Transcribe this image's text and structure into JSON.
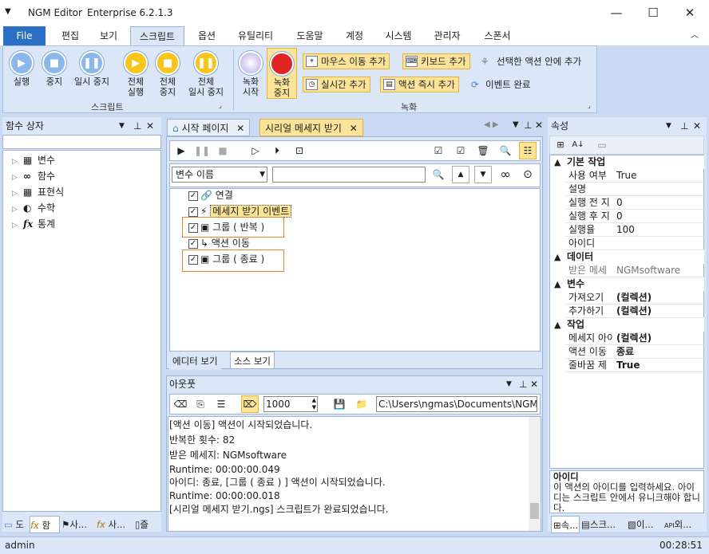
{
  "window": {
    "app_name": "NGM Editor",
    "edition": "Enterprise 6.2.1.3",
    "minimize": "—",
    "maximize": "☐",
    "close": "✕"
  },
  "menu": {
    "file": "File",
    "tabs": [
      "편집",
      "보기",
      "스크립트",
      "옵션",
      "유틸리티",
      "도움말",
      "계정",
      "시스템",
      "관리자",
      "스폰서"
    ]
  },
  "ribbon": {
    "script_group": {
      "label": "스크립트",
      "run": "실행",
      "stop": "중지",
      "pause": "일시 중지",
      "run_all_1": "전체",
      "run_all_2": "실행",
      "stop_all_1": "전체",
      "stop_all_2": "중지",
      "pause_all_1": "전체",
      "pause_all_2": "일시 중지"
    },
    "record_group": {
      "label": "녹화",
      "rec_start_1": "녹화",
      "rec_start_2": "시작",
      "rec_stop_1": "녹화",
      "rec_stop_2": "중지",
      "add_mouse": "마우스 이동 추가",
      "add_keyboard": "키보드 추가",
      "add_in_selected": "선택한 액션 안에 추가",
      "add_realtime": "실시간 추가",
      "add_action_now": "액션 즉시 추가",
      "event_done": "이벤트 완료"
    }
  },
  "left_panel": {
    "title": "함수 상자",
    "items": [
      {
        "label": "변수",
        "icon": "▦"
      },
      {
        "label": "함수",
        "icon": "∞"
      },
      {
        "label": "표현식",
        "icon": "▦"
      },
      {
        "label": "수학",
        "icon": "◐"
      },
      {
        "label": "통계",
        "icon": "fx"
      }
    ],
    "bottom_tabs": [
      "도",
      "함",
      "사...",
      "사...",
      "즐"
    ]
  },
  "editor": {
    "tabs": [
      "시작 페이지",
      "시리얼 메세지 받기"
    ],
    "filter_select": "변수 이름",
    "filter_input": "",
    "actions": [
      {
        "label": "연결",
        "icon": "🔗",
        "checked": true
      },
      {
        "label": "메세지 받기 이벤트",
        "icon": "⚡",
        "checked": true
      },
      {
        "label": "그룹 ( 반복 )",
        "icon": "▣",
        "checked": true
      },
      {
        "label": "액션 이동",
        "icon": "↳",
        "checked": true
      },
      {
        "label": "그룹 ( 종료 )",
        "icon": "▣",
        "checked": true
      }
    ],
    "view_tabs": [
      "에디터 보기",
      "소스 보기"
    ]
  },
  "output": {
    "title": "아웃풋",
    "count_value": "1000",
    "path": "C:\\Users\\ngmas\\Documents\\NGM6\\",
    "lines": [
      "[액션 이동] 액션이 시작되었습니다.",
      "반복한 횟수: 82",
      "받은 메세지: NGMsoftware",
      "Runtime: 00:00:00.049",
      "아이디: 종료, [그룹 ( 종료 ) ] 액션이 시작되었습니다.",
      "Runtime: 00:00:00.018",
      "[시리얼 메세지 받기.ngs] 스크립트가 완료되었습니다."
    ]
  },
  "properties": {
    "title": "속성",
    "categories": [
      {
        "name": "기본 작업",
        "rows": [
          [
            "사용 여부",
            "True"
          ],
          [
            "설명",
            ""
          ],
          [
            "실행 전 지",
            "0"
          ],
          [
            "실행 후 지",
            "0"
          ],
          [
            "실행율",
            "100"
          ],
          [
            "아이디",
            ""
          ]
        ]
      },
      {
        "name": "데이터",
        "rows": [
          [
            "받은 메세",
            "NGMsoftware"
          ]
        ]
      },
      {
        "name": "변수",
        "rows": [
          [
            "가져오기",
            "(컬렉션)"
          ],
          [
            "추가하기",
            "(컬렉션)"
          ]
        ]
      },
      {
        "name": "작업",
        "rows": [
          [
            "메세지 아이",
            "(컬렉션)"
          ],
          [
            "액션 이동",
            "종료"
          ],
          [
            "줄바꿈 제",
            "True"
          ]
        ]
      }
    ],
    "help_title": "아이디",
    "help_text": "이 액션의 아이디를 입력하세요. 아이디는 스크립트 안에서 유니크해야 합니다.",
    "bottom_tabs": [
      "속...",
      "스크...",
      "이...",
      "외..."
    ]
  },
  "status": {
    "user": "admin",
    "time": "00:28:51"
  }
}
